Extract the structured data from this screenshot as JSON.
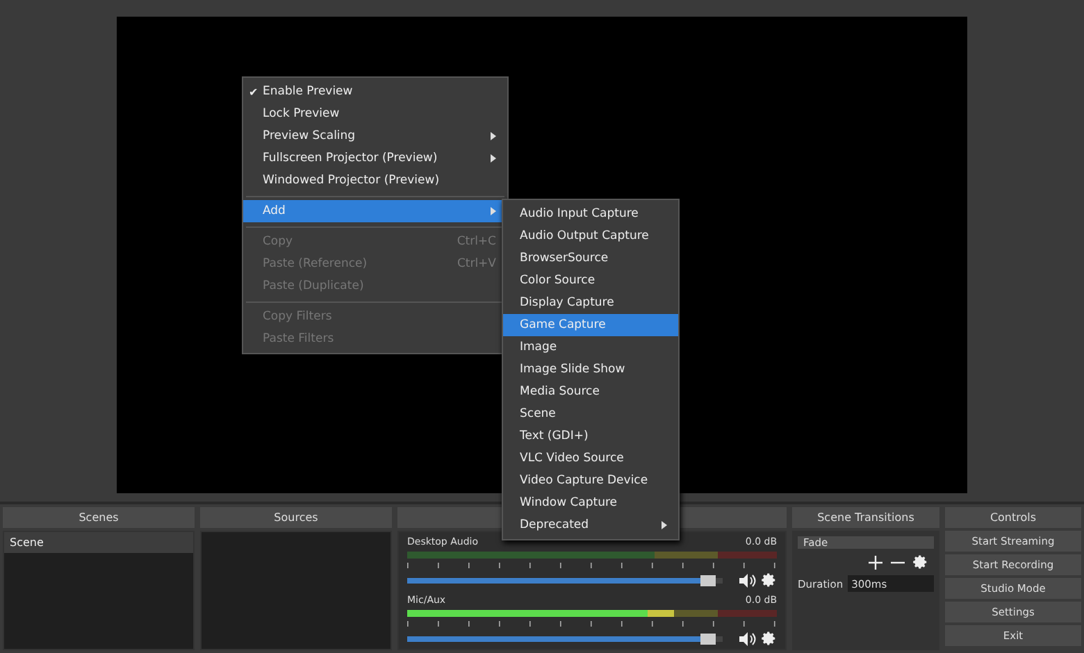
{
  "context_menu": {
    "check_mark": "✔",
    "items": [
      {
        "kind": "item",
        "label": "Enable Preview",
        "checked": true,
        "disabled": false,
        "selected": false,
        "submenu": false
      },
      {
        "kind": "item",
        "label": "Lock Preview",
        "checked": false,
        "disabled": false,
        "selected": false,
        "submenu": false
      },
      {
        "kind": "item",
        "label": "Preview Scaling",
        "checked": false,
        "disabled": false,
        "selected": false,
        "submenu": true
      },
      {
        "kind": "item",
        "label": "Fullscreen Projector (Preview)",
        "checked": false,
        "disabled": false,
        "selected": false,
        "submenu": true
      },
      {
        "kind": "item",
        "label": "Windowed Projector (Preview)",
        "checked": false,
        "disabled": false,
        "selected": false,
        "submenu": false
      },
      {
        "kind": "separator"
      },
      {
        "kind": "item",
        "label": "Add",
        "checked": false,
        "disabled": false,
        "selected": true,
        "submenu": true
      },
      {
        "kind": "separator"
      },
      {
        "kind": "item",
        "label": "Copy",
        "shortcut": "Ctrl+C",
        "checked": false,
        "disabled": true,
        "selected": false,
        "submenu": false
      },
      {
        "kind": "item",
        "label": "Paste (Reference)",
        "shortcut": "Ctrl+V",
        "checked": false,
        "disabled": true,
        "selected": false,
        "submenu": false
      },
      {
        "kind": "item",
        "label": "Paste (Duplicate)",
        "checked": false,
        "disabled": true,
        "selected": false,
        "submenu": false
      },
      {
        "kind": "separator"
      },
      {
        "kind": "item",
        "label": "Copy Filters",
        "checked": false,
        "disabled": true,
        "selected": false,
        "submenu": false
      },
      {
        "kind": "item",
        "label": "Paste Filters",
        "checked": false,
        "disabled": true,
        "selected": false,
        "submenu": false
      }
    ]
  },
  "add_submenu": {
    "items": [
      {
        "label": "Audio Input Capture",
        "selected": false,
        "submenu": false
      },
      {
        "label": "Audio Output Capture",
        "selected": false,
        "submenu": false
      },
      {
        "label": "BrowserSource",
        "selected": false,
        "submenu": false
      },
      {
        "label": "Color Source",
        "selected": false,
        "submenu": false
      },
      {
        "label": "Display Capture",
        "selected": false,
        "submenu": false
      },
      {
        "label": "Game Capture",
        "selected": true,
        "submenu": false
      },
      {
        "label": "Image",
        "selected": false,
        "submenu": false
      },
      {
        "label": "Image Slide Show",
        "selected": false,
        "submenu": false
      },
      {
        "label": "Media Source",
        "selected": false,
        "submenu": false
      },
      {
        "label": "Scene",
        "selected": false,
        "submenu": false
      },
      {
        "label": "Text (GDI+)",
        "selected": false,
        "submenu": false
      },
      {
        "label": "VLC Video Source",
        "selected": false,
        "submenu": false
      },
      {
        "label": "Video Capture Device",
        "selected": false,
        "submenu": false
      },
      {
        "label": "Window Capture",
        "selected": false,
        "submenu": false
      },
      {
        "label": "Deprecated",
        "selected": false,
        "submenu": true
      }
    ]
  },
  "scenes": {
    "title": "Scenes",
    "items": [
      {
        "label": "Scene",
        "selected": true
      }
    ]
  },
  "sources": {
    "title": "Sources"
  },
  "mixer": {
    "channels": [
      {
        "name": "Desktop Audio",
        "reading": "0.0 dB",
        "meter": {
          "level": 0
        },
        "volume": {
          "level": 0.95
        }
      },
      {
        "name": "Mic/Aux",
        "reading": "0.0 dB",
        "meter": {
          "level": 0.72
        },
        "volume": {
          "level": 0.95
        }
      }
    ]
  },
  "scene_transitions": {
    "title": "Scene Transitions",
    "transition": "Fade",
    "duration_label": "Duration",
    "duration": "300ms"
  },
  "controls": {
    "title": "Controls",
    "buttons": [
      "Start Streaming",
      "Start Recording",
      "Studio Mode",
      "Settings",
      "Exit"
    ]
  }
}
